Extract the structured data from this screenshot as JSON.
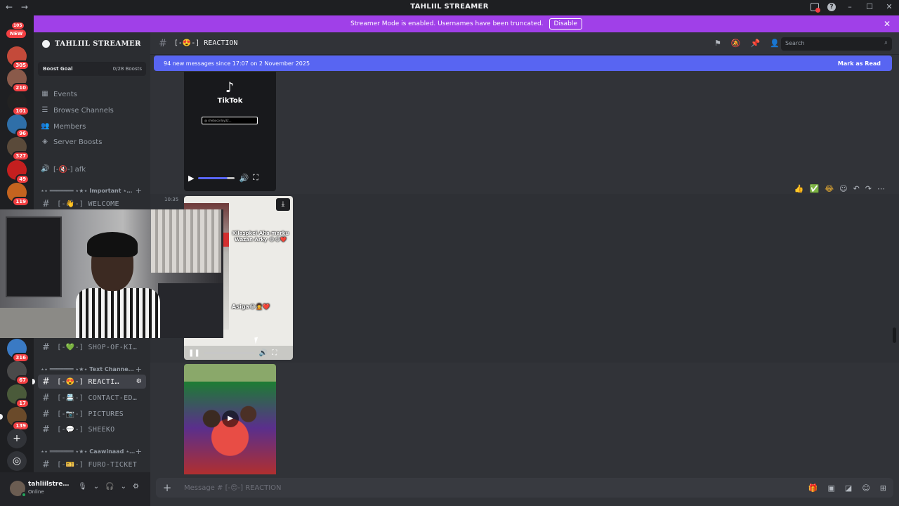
{
  "window": {
    "title": "TAHLIIL STREAMER",
    "back_icon": "arrow-left-icon",
    "forward_icon": "arrow-right-icon"
  },
  "streamer_banner": {
    "text": "Streamer Mode is enabled. Usernames have been truncated.",
    "button": "Disable"
  },
  "guilds": {
    "top_badge": "105",
    "new_label": "NEW",
    "items": [
      {
        "badge": "305",
        "color": "#c44a3a"
      },
      {
        "badge": "210",
        "color": "#8a5a4a"
      },
      {
        "badge": "101",
        "color": "#222222"
      },
      {
        "badge": "96",
        "color": "#2f6fa8"
      },
      {
        "badge": "327",
        "color": "#5a4a3a"
      },
      {
        "badge": "49",
        "color": "#c41f1f"
      },
      {
        "badge": "119",
        "color": "#c4641f"
      },
      {
        "badge": "316",
        "color": "#3a7ac4"
      },
      {
        "badge": "67",
        "color": "#4a4a4a"
      },
      {
        "badge": "17",
        "color": "#4a5a3a"
      },
      {
        "badge": "139",
        "color": "#6a4a2a"
      }
    ]
  },
  "sidebar": {
    "server_name": "TAHLIIL STREAMER",
    "boost_goal": "Boost Goal",
    "boost_count": "0/28 Boosts",
    "links": [
      {
        "label": "Events",
        "icon": "calendar-icon"
      },
      {
        "label": "Browse Channels",
        "icon": "browse-channels-icon"
      },
      {
        "label": "Members",
        "icon": "members-icon"
      },
      {
        "label": "Server Boosts",
        "icon": "boost-icon"
      }
    ],
    "afk_channel": "[-🔇-] afk",
    "categories": {
      "important": "⋆⋆ ═══════ ⋆★⋆ Important ⋆…",
      "text": "⋆⋆ ═══════ ⋆★⋆ Text Channe…",
      "caawinaad": "⋆⋆ ═══════ ⋆★⋆ Caawinaad ⋆…"
    },
    "channels": {
      "welcome": "[-👋-] WELCOME",
      "shop": "[-💚-] SHOP-OF-KI…",
      "reaction": "[-😍-] REACTI…",
      "contact": "[-📇-] CONTACT-ED…",
      "pictures": "[-📷-] PICTURES",
      "sheeko": "[-💬-] SHEEKO",
      "furo": "[-🎫-] FURO-TICKET"
    }
  },
  "channel_header": {
    "name": "[-😍-] REACTION",
    "search_placeholder": "Search",
    "icons": [
      "threads-icon",
      "mute-icon",
      "pin-icon",
      "members-list-icon"
    ]
  },
  "new_messages": {
    "text": "94 new messages since 17:07 on 2 November 2025",
    "action": "Mark as Read"
  },
  "messages": {
    "tiktok_name": "TikTok",
    "tiktok_handle": "@ shebocorloy32...",
    "timestamp": "10:35",
    "video_caption_top": "Kilaspkei Aha marku Wazan Arky 😂😂❤️",
    "video_caption_bottom": "Asiga😂🧑‍🦱❤️",
    "reactions": [
      "👍",
      "✅",
      "😂"
    ]
  },
  "composer": {
    "placeholder": "Message # [-😍-] REACTION"
  },
  "user": {
    "name": "tahliilstre…",
    "status": "Online"
  },
  "colors": {
    "banner": "#a040e8",
    "new_messages_bar": "#5865f2",
    "unread_badge": "#f23f42",
    "online": "#23a55a"
  }
}
